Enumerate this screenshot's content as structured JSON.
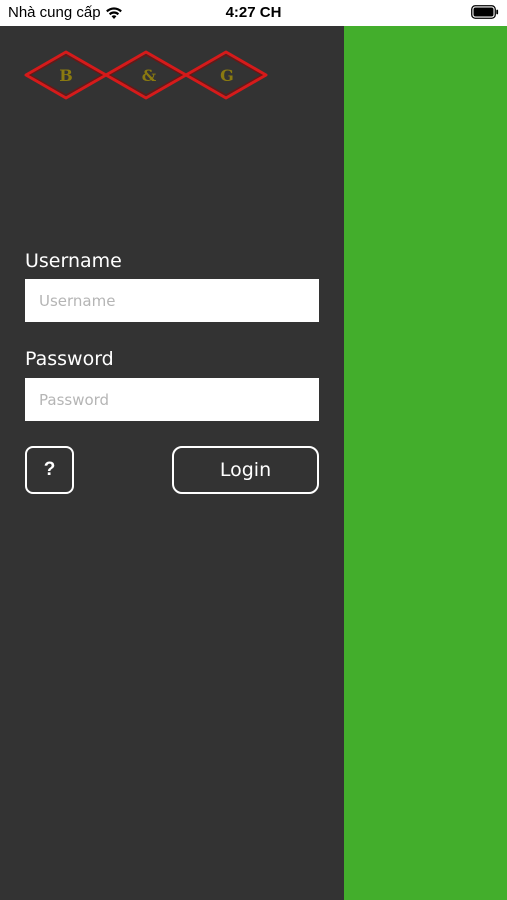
{
  "status_bar": {
    "carrier": "Nhà cung cấp",
    "time": "4:27 CH",
    "wifi_icon": "wifi-icon",
    "battery_icon": "battery-icon"
  },
  "logo": {
    "letters": [
      "B",
      "&",
      "G"
    ],
    "border_color": "#d61a1a",
    "letter_color": "#8a7a10"
  },
  "form": {
    "username_label": "Username",
    "username_placeholder": "Username",
    "username_value": "",
    "password_label": "Password",
    "password_placeholder": "Password",
    "password_value": "",
    "help_label": "?",
    "login_label": "Login"
  },
  "colors": {
    "drawer_bg": "#333333",
    "green_panel": "#43ae2c"
  }
}
